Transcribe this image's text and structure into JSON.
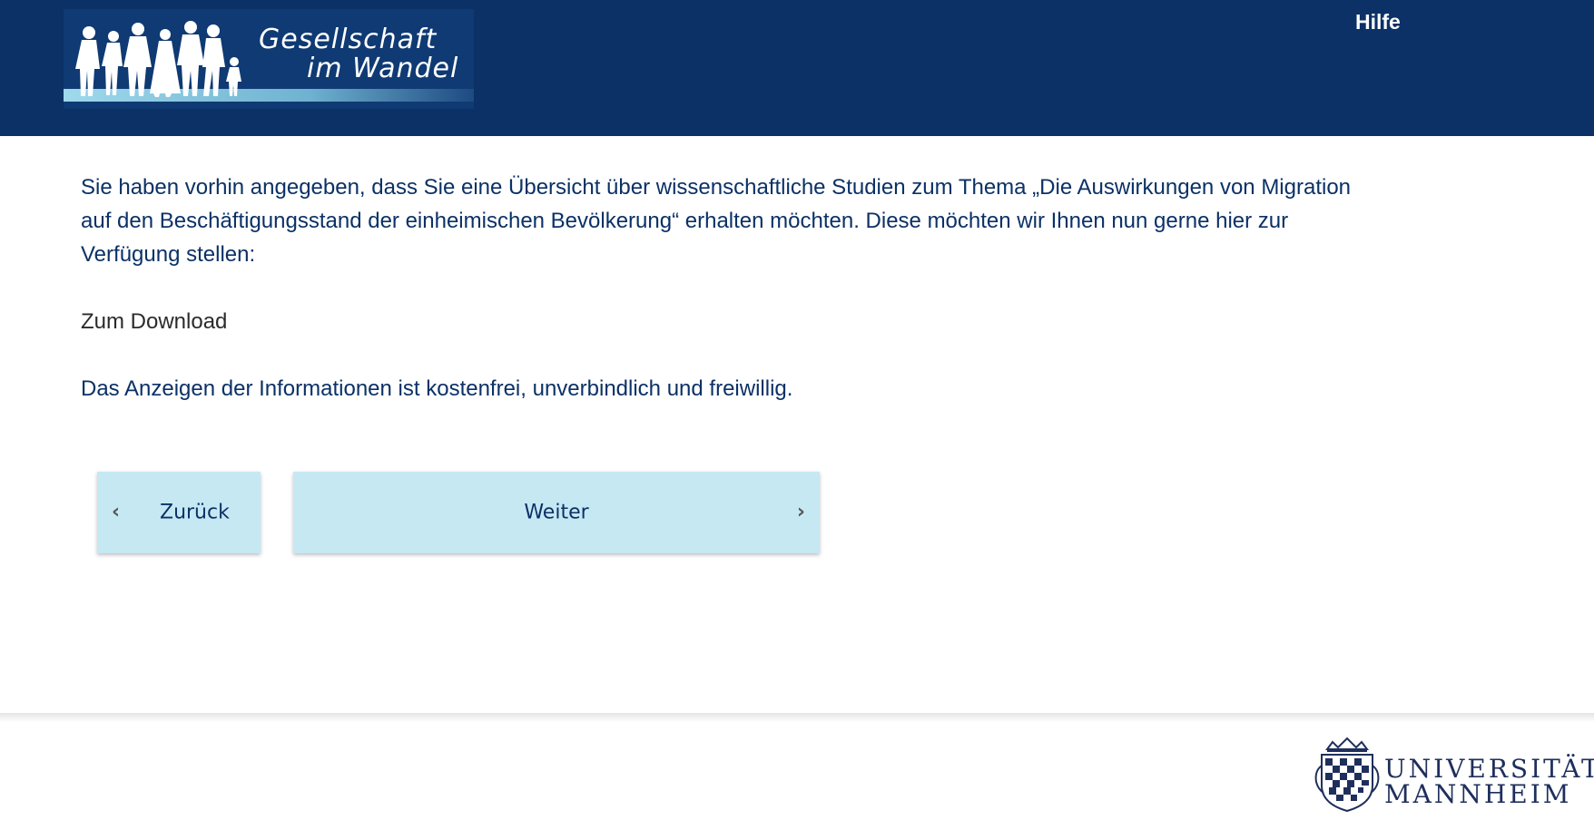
{
  "header": {
    "logo_line1": "Gesellschaft",
    "logo_line2": "im Wandel",
    "help_label": "Hilfe"
  },
  "main": {
    "intro_text": "Sie haben vorhin angegeben, dass Sie eine Übersicht über wissenschaftliche Studien zum Thema „Die Auswirkungen von Migration auf den Beschäftigungsstand der einheimischen Bevölkerung“ erhalten möchten. Diese möchten wir Ihnen nun gerne hier zur Verfügung stellen:",
    "download_label": "Zum Download",
    "note_text": "Das Anzeigen der Informationen ist kostenfrei, unverbindlich und freiwillig."
  },
  "navigation": {
    "back_label": "Zurück",
    "next_label": "Weiter",
    "back_icon": "chevron-left-icon",
    "next_icon": "chevron-right-icon"
  },
  "footer": {
    "university_line1": "UNIVERSITÄT",
    "university_line2": "MANNHEIM"
  },
  "colors": {
    "header_bg": "#0b3166",
    "text": "#0b3166",
    "button_bg": "#c6e8f3",
    "download_text": "#2b2b2b"
  }
}
